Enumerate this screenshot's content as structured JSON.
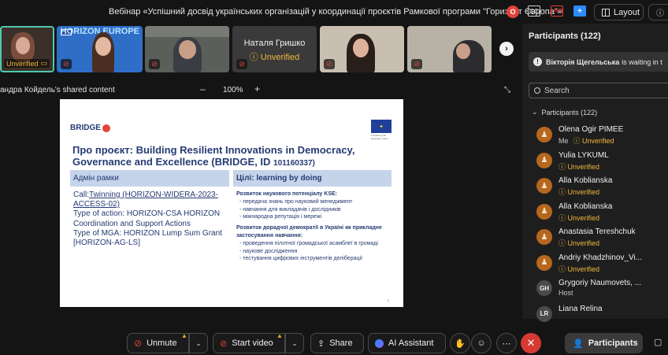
{
  "meeting": {
    "title": "Вебінар «Успішний досвід українських організацій у координації проєктів Рамкової програми \"Горизонт Європа\"»",
    "rec_label": "O",
    "cc_label": "CC",
    "live_label": "LIVE",
    "plus_label": "+",
    "layout_label": "Layout",
    "shield_label": "ⓘ"
  },
  "video_strip": {
    "tile1_status": "Unverified",
    "tile2_text": "HORIZON EUROPE",
    "tile4_name": "Наталя Гришко",
    "tile4_status": "Unverified",
    "next_label": "›"
  },
  "share": {
    "label": "андра Койдель's shared content",
    "zoom_minus": "–",
    "zoom_value": "100%",
    "zoom_plus": "+",
    "expand": "⤡"
  },
  "slide": {
    "brand": "BRIDGE",
    "eu_caption": "Funded by the European Union",
    "title_main": "Про проєкт: Building Resilient Innovations in Democracy, Governance and Excellence (BRIDGE, ID ",
    "title_id": "101160337)",
    "left_head": "Адмін рамки",
    "left_call_prefix": "Call:",
    "left_call_link": "Twinning (HORIZON-WIDERA-2023-ACCESS-02)",
    "left_action": "Type of action: HORIZON-CSA HORIZON Coordination and Support Actions",
    "left_mga": "Type of MGA: HORIZON Lump Sum Grant [HORIZON-AG-LS]",
    "right_head": "Цілі: learning by doing",
    "right_h1": "Розвиток наукового потенціалу KSE:",
    "right_list1": [
      "передача знань про науковий менеджмент",
      "навчання для викладачів і дослідників",
      "міжнародна репутація і мережі"
    ],
    "right_h2": "Розвиток дорадчої демократії в Україні як прикладне застосування навчання:",
    "right_list2": [
      "проведення пілотної громадської асамблеї в громаді",
      "наукове дослідження",
      "тестування цифрових інструментів деліберації"
    ],
    "page_number": "2"
  },
  "participants_panel": {
    "title": "Participants (122)",
    "waiting_name": "Вікторія Щегельська",
    "waiting_text": "is waiting in t",
    "search_placeholder": "Search",
    "group_label": "Participants (122)",
    "people": [
      {
        "name": "Olena Ogir PIMEE",
        "me": "Me",
        "status": "Unverified",
        "initials": ""
      },
      {
        "name": "Yulia LYKUML",
        "status": "Unverified",
        "initials": ""
      },
      {
        "name": "Alla Koblianska",
        "status": "Unverified",
        "initials": ""
      },
      {
        "name": "Alla Koblianska",
        "status": "Unverified",
        "initials": ""
      },
      {
        "name": "Anastasia Tereshchuk",
        "status": "Unverified",
        "initials": ""
      },
      {
        "name": "Andriy Khadzhinov_Vi...",
        "status": "Unverified",
        "initials": ""
      },
      {
        "name": "Grygoriy Naumovets, ...",
        "role": "Host",
        "initials": "GH"
      },
      {
        "name": "Liana Relina",
        "initials": "LR"
      }
    ]
  },
  "toolbar": {
    "unmute_label": "Unmute",
    "video_label": "Start video",
    "share_label": "Share",
    "ai_label": "AI Assistant",
    "participants_label": "Participants"
  },
  "colors": {
    "accent": "#2d8cff",
    "warning": "#f0b73c",
    "danger": "#d63a33",
    "avatar": "#b5671e"
  }
}
